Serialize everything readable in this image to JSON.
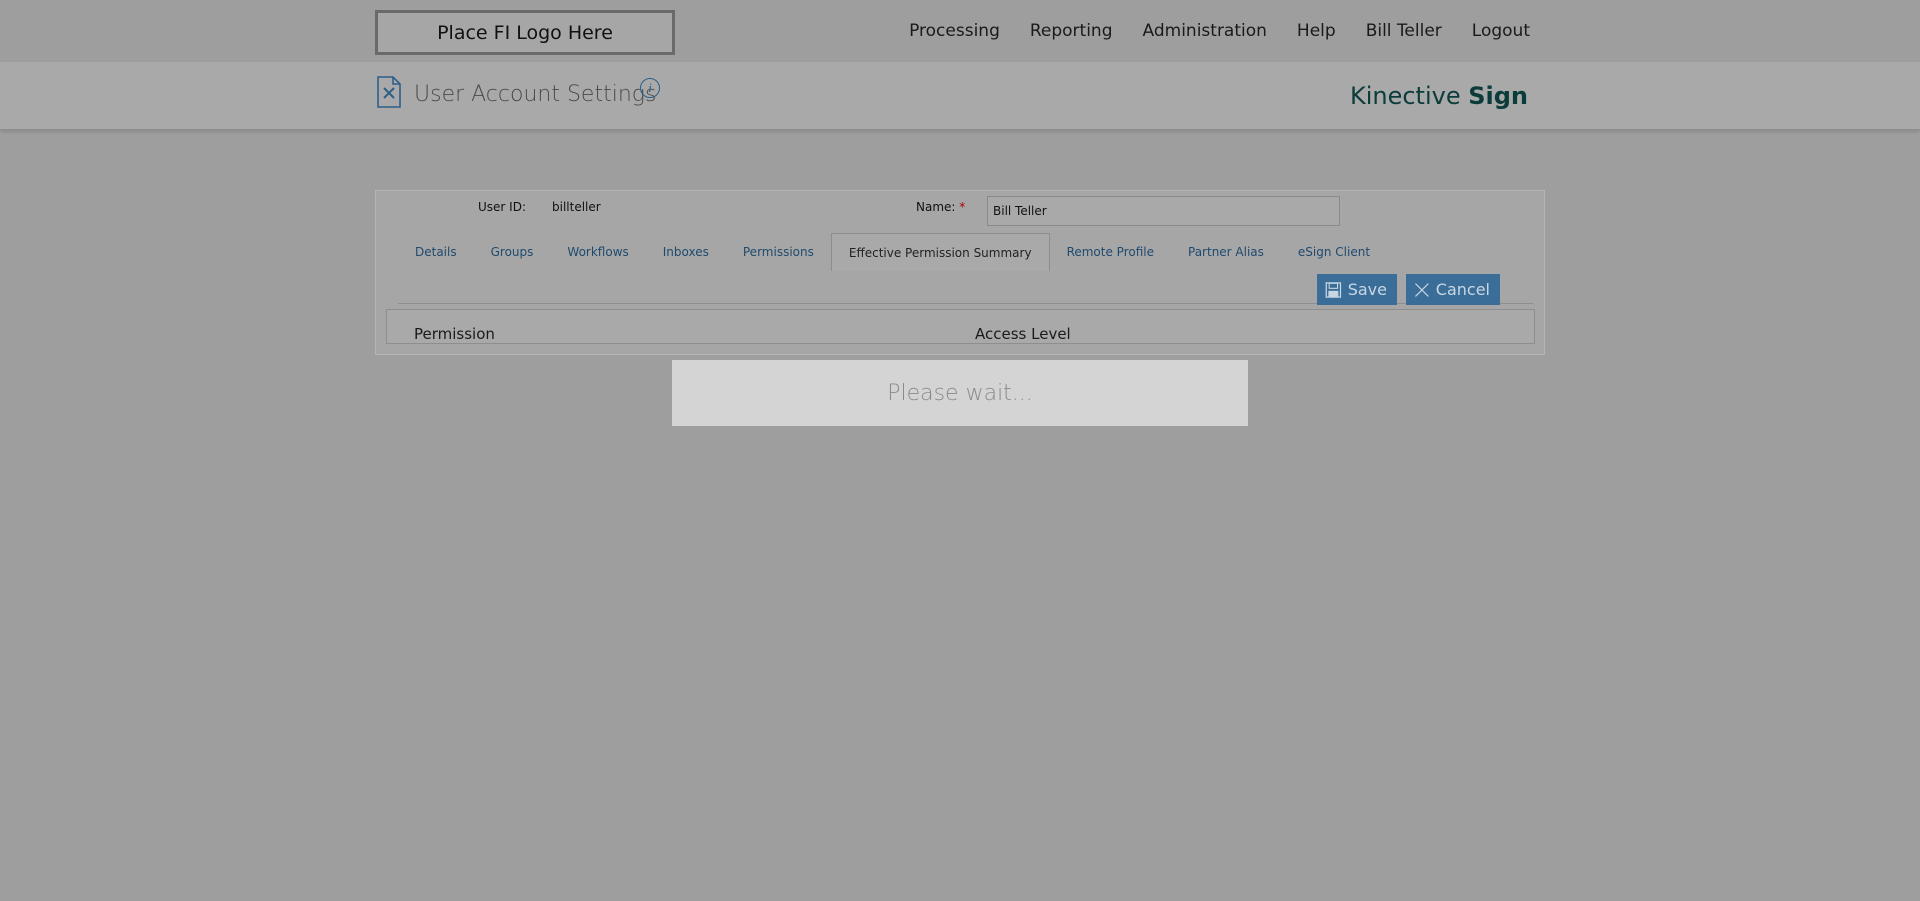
{
  "header": {
    "logo_text": "Place FI Logo Here",
    "nav": [
      "Processing",
      "Reporting",
      "Administration",
      "Help",
      "Bill Teller",
      "Logout"
    ]
  },
  "titlebar": {
    "title": "User Account Settings",
    "info_glyph": "i",
    "brand_light": "Kinective ",
    "brand_bold": "Sign"
  },
  "form": {
    "user_id_label": "User ID:",
    "user_id_value": "billteller",
    "name_label": "Name:",
    "name_required_mark": "*",
    "name_value": "Bill Teller"
  },
  "tabs": [
    {
      "label": "Details",
      "active": false
    },
    {
      "label": "Groups",
      "active": false
    },
    {
      "label": "Workflows",
      "active": false
    },
    {
      "label": "Inboxes",
      "active": false
    },
    {
      "label": "Permissions",
      "active": false
    },
    {
      "label": "Effective Permission Summary",
      "active": true
    },
    {
      "label": "Remote Profile",
      "active": false
    },
    {
      "label": "Partner Alias",
      "active": false
    },
    {
      "label": "eSign Client",
      "active": false
    }
  ],
  "toolbar": {
    "save_label": "Save",
    "cancel_label": "Cancel"
  },
  "grid": {
    "columns": [
      "Permission",
      "Access Level"
    ]
  },
  "overlay": {
    "wait_text": "Please wait..."
  },
  "colors": {
    "accent": "#3a6d98",
    "link": "#1f4a6e",
    "brand": "#0b3c3a",
    "required": "#b30000"
  }
}
